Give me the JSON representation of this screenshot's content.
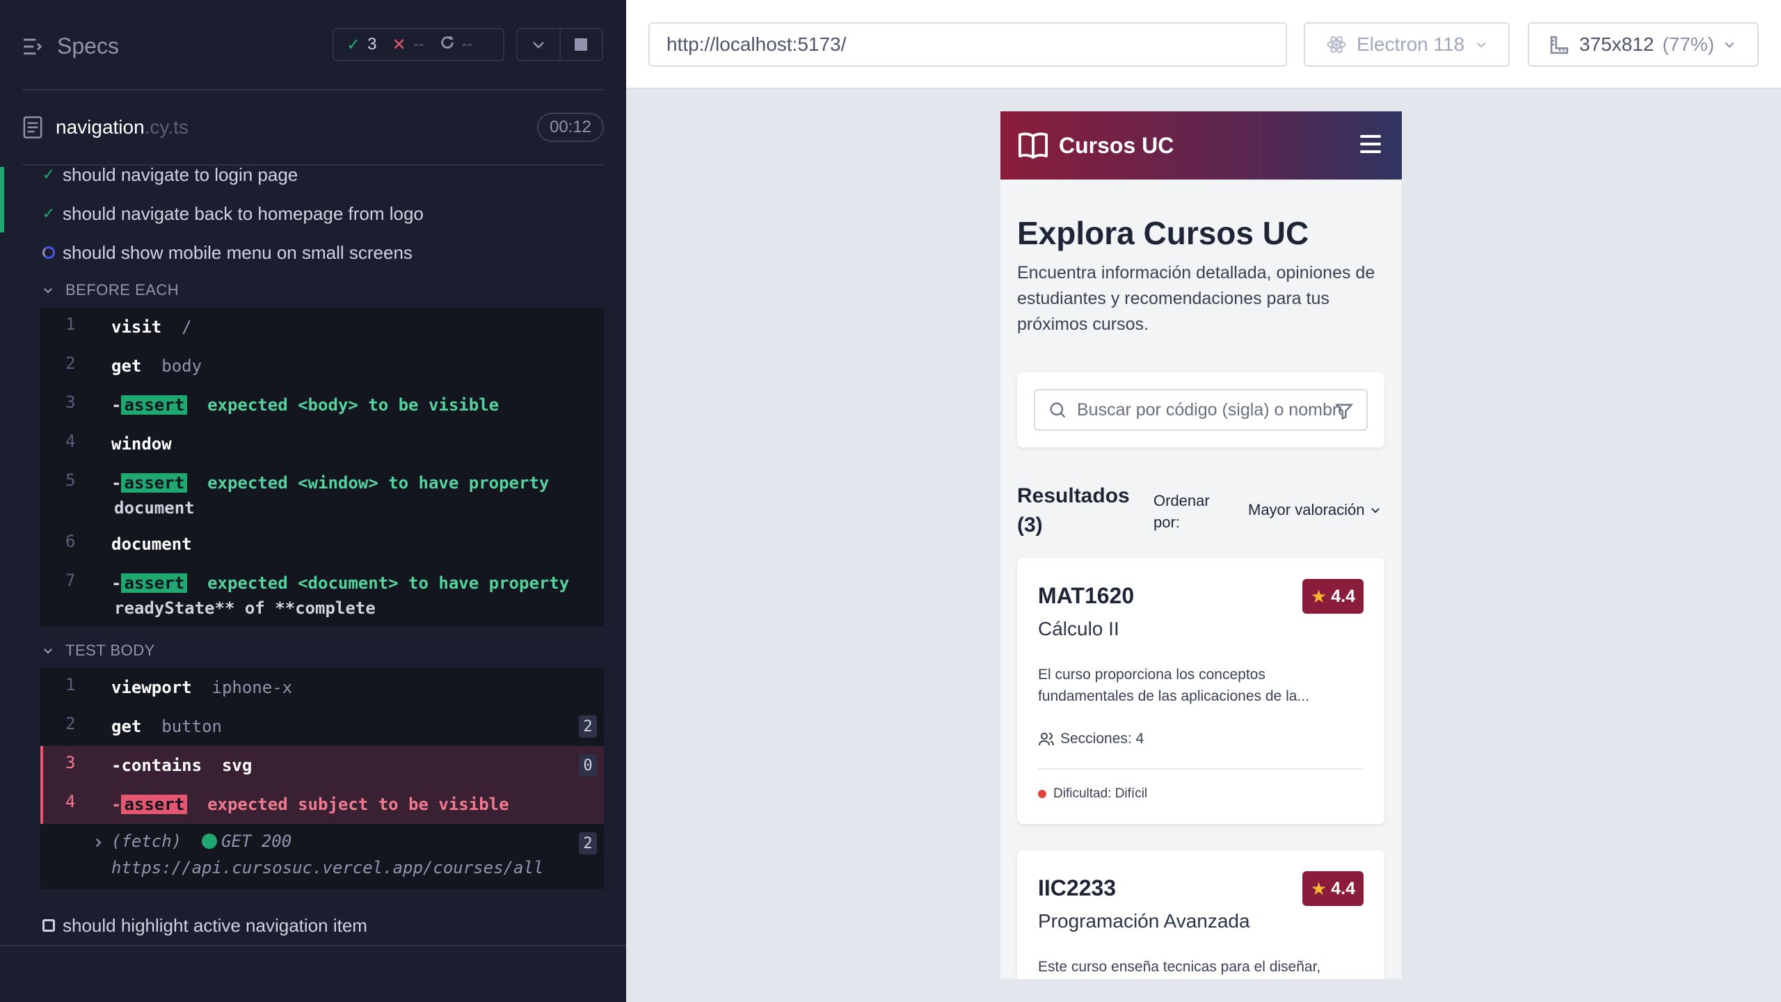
{
  "reporter": {
    "specs_label": "Specs",
    "stats": {
      "passed": "3",
      "failed": "--",
      "pending": "--"
    },
    "file": {
      "name": "navigation",
      "ext": ".cy.ts",
      "duration": "00:12"
    },
    "tests": [
      {
        "label": "should navigate to login page",
        "state": "passed"
      },
      {
        "label": "should navigate back to homepage from logo",
        "state": "passed"
      },
      {
        "label": "should show mobile menu on small screens",
        "state": "running"
      },
      {
        "label": "should highlight active navigation item",
        "state": "queued"
      }
    ],
    "before_each": {
      "title": "BEFORE EACH",
      "commands": [
        {
          "no": "1",
          "name": "visit",
          "arg": "/"
        },
        {
          "no": "2",
          "name": "get",
          "arg": "body"
        },
        {
          "no": "3",
          "badge": "assert",
          "text": "expected <body> to be visible"
        },
        {
          "no": "4",
          "name": "window",
          "arg": ""
        },
        {
          "no": "5",
          "badge": "assert",
          "text": "expected <window> to have property",
          "text2": "document"
        },
        {
          "no": "6",
          "name": "document",
          "arg": ""
        },
        {
          "no": "7",
          "badge": "assert",
          "text": "expected <document> to have property",
          "text2": "readyState** of **complete"
        }
      ]
    },
    "test_body": {
      "title": "TEST BODY",
      "commands": [
        {
          "no": "1",
          "name": "viewport",
          "arg": "iphone-x"
        },
        {
          "no": "2",
          "name": "get",
          "arg": "button",
          "count": "2"
        },
        {
          "no": "3",
          "name": "-contains",
          "arg": "svg",
          "count": "0"
        },
        {
          "no": "4",
          "badge": "assert",
          "text": "expected subject to be visible"
        }
      ],
      "fetch": {
        "label": "(fetch)",
        "method": "GET 200",
        "url": "https://api.cursosuc.vercel.app/courses/all",
        "count": "2"
      }
    }
  },
  "aut": {
    "url": "http://localhost:5173/",
    "browser": "Electron 118",
    "viewport": "375x812",
    "scale": "(77%)"
  },
  "app": {
    "brand": "Cursos UC",
    "hero_title": "Explora Cursos UC",
    "hero_subtitle": "Encuentra información detallada, opiniones de estudiantes y recomendaciones para tus próximos cursos.",
    "search_placeholder": "Buscar por código (sigla) o nombre",
    "results_label": "Resultados (3)",
    "order_label": "Ordenar por:",
    "order_value": "Mayor valoración",
    "courses": [
      {
        "code": "MAT1620",
        "name": "Cálculo II",
        "rating": "4.4",
        "description": "El curso proporciona los conceptos fundamentales de las aplicaciones de la...",
        "sections": "Secciones: 4",
        "difficulty": "Dificultad: Difícil"
      },
      {
        "code": "IIC2233",
        "name": "Programación Avanzada",
        "rating": "4.4",
        "description": "Este curso enseña tecnicas para el diseñar,"
      }
    ]
  },
  "colors": {
    "pass": "#1fa971",
    "fail": "#e45770",
    "brand": "#8a1d3b"
  }
}
